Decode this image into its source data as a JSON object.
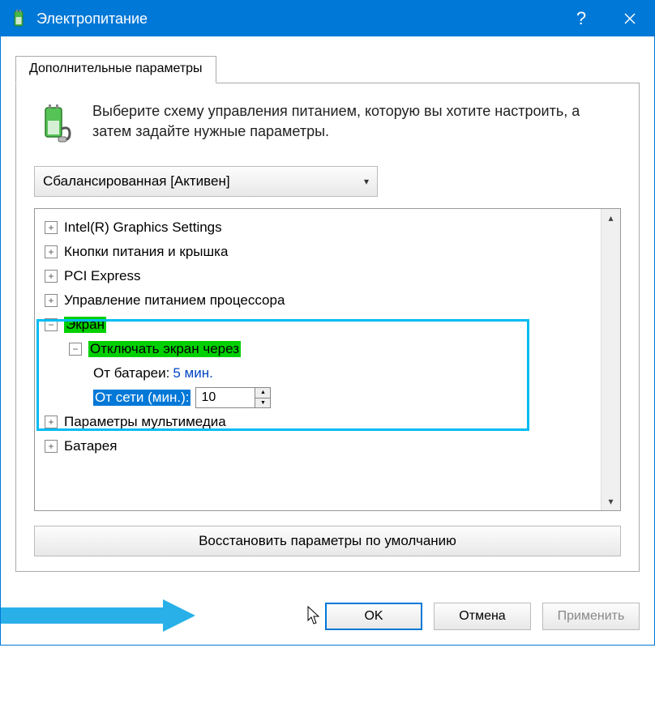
{
  "titlebar": {
    "title": "Электропитание"
  },
  "tab": {
    "label": "Дополнительные параметры"
  },
  "intro": {
    "text": "Выберите схему управления питанием, которую вы хотите настроить, а затем задайте нужные параметры."
  },
  "scheme": {
    "selected": "Сбалансированная [Активен]"
  },
  "tree": {
    "intel": "Intel(R) Graphics Settings",
    "buttons_lid": "Кнопки питания и крышка",
    "pci": "PCI Express",
    "cpu_power": "Управление питанием процессора",
    "screen": "Экран",
    "screen_off": "Отключать экран через",
    "battery_label": "От батареи:",
    "battery_value": "5 мин.",
    "plugged_label": "От сети (мин.):",
    "plugged_value": "10",
    "multimedia": "Параметры мультимедиа",
    "battery_section": "Батарея"
  },
  "buttons": {
    "restore": "Восстановить параметры по умолчанию",
    "ok": "OK",
    "cancel": "Отмена",
    "apply": "Применить"
  }
}
